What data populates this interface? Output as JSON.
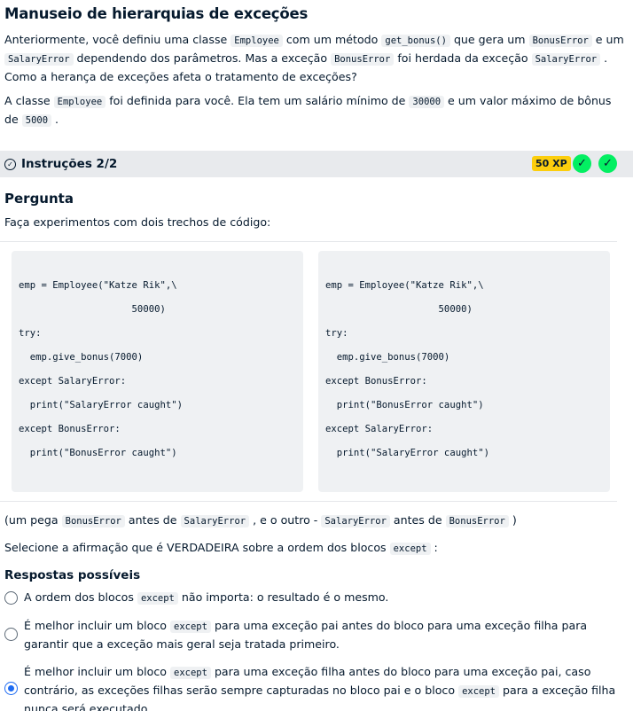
{
  "header": {
    "title": "Manuseio de hierarquias de exceções"
  },
  "intro": {
    "p1_a": "Anteriormente, você definiu uma classe ",
    "p1_code1": "Employee",
    "p1_b": " com um método ",
    "p1_code2": "get_bonus()",
    "p1_c": " que gera um ",
    "p1_code3": "BonusError",
    "p1_d": " e um ",
    "p1_code4": "SalaryError",
    "p1_e": " dependendo dos parâmetros. Mas a exceção ",
    "p1_code5": "BonusError",
    "p1_f": " foi herdada da exceção ",
    "p1_code6": "SalaryError",
    "p1_g": " . Como a herança de exceções afeta o tratamento de exceções?",
    "p2_a": "A classe ",
    "p2_code1": "Employee",
    "p2_b": " foi definida para você. Ela tem um salário mínimo de ",
    "p2_code2": "30000",
    "p2_c": " e um valor máximo de bônus de ",
    "p2_code3": "5000",
    "p2_d": " ."
  },
  "instructions": {
    "label": "Instruções 2/2",
    "xp": "50 XP",
    "check": "✓"
  },
  "question": {
    "heading": "Pergunta",
    "prompt": "Faça experimentos com dois trechos de código:",
    "code_left": [
      "emp = Employee(\"Katze Rik\",\\",
      "                    50000)",
      "try:",
      "  emp.give_bonus(7000)",
      "except SalaryError:",
      "  print(\"SalaryError caught\")",
      "except BonusError:",
      "  print(\"BonusError caught\")"
    ],
    "code_right": [
      "emp = Employee(\"Katze Rik\",\\",
      "                    50000)",
      "try:",
      "  emp.give_bonus(7000)",
      "except BonusError:",
      "  print(\"BonusError caught\")",
      "except SalaryError:",
      "  print(\"SalaryError caught\")"
    ],
    "note_a": "(um pega ",
    "note_code1": "BonusError",
    "note_b": " antes de ",
    "note_code2": "SalaryError",
    "note_c": " , e o outro - ",
    "note_code3": "SalaryError",
    "note_d": " antes de ",
    "note_code4": "BonusError",
    "note_e": " )",
    "select_a": "Selecione a afirmação que é VERDADEIRA sobre a ordem dos blocos ",
    "select_code": "except",
    "select_b": " :"
  },
  "answers": {
    "heading": "Respostas possíveis",
    "opt1_a": "A ordem dos blocos ",
    "opt1_code": "except",
    "opt1_b": " não importa: o resultado é o mesmo.",
    "opt2_a": "É melhor incluir um bloco ",
    "opt2_code": "except",
    "opt2_b": " para uma exceção pai antes do bloco para uma exceção filha para garantir que a exceção mais geral seja tratada primeiro.",
    "opt3_a": "É melhor incluir um bloco ",
    "opt3_code1": "except",
    "opt3_b": " para uma exceção filha antes do bloco para uma exceção pai, caso contrário, as exceções filhas serão sempre capturadas no bloco pai e o bloco ",
    "opt3_code2": "except",
    "opt3_c": " para a exceção filha nunca será executado."
  }
}
